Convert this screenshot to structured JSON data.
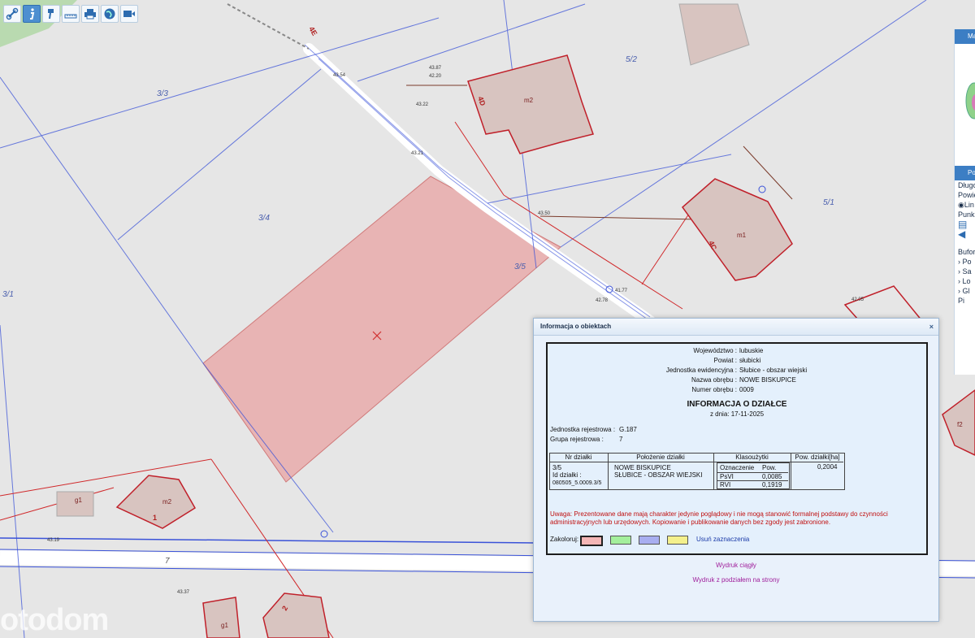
{
  "toolbar": {
    "tools": [
      "link-icon",
      "info-icon",
      "identify-icon",
      "measure-icon",
      "print-icon",
      "globe-icon",
      "video-icon"
    ]
  },
  "map": {
    "parcel_labels": [
      "3/3",
      "3/4",
      "3/5",
      "3/1",
      "5/2",
      "5/1",
      "4E",
      "4D",
      "4C",
      "7"
    ],
    "building_labels": [
      "m2",
      "m1",
      "m2",
      "g1",
      "g1",
      "1",
      "2",
      "f2"
    ],
    "elevations": [
      "43.54",
      "43.21",
      "43.50",
      "42.78",
      "42.20",
      "43.22",
      "43.87",
      "43.19",
      "43.37",
      "42.05",
      "41.77"
    ],
    "colors": {
      "selected_parcel": "#e8b4b4",
      "parcel_line": "#3a52d8",
      "road": "#ffffff",
      "building": "#d8c4c0",
      "building_line": "#c0202a"
    }
  },
  "side_panel": {
    "head1": "Ma",
    "head2": "Po",
    "rows": [
      "Długo",
      "Powie",
      "Lin",
      "Punk",
      "Bufor[",
      "Po",
      "Sa",
      "Lo",
      "Gl",
      "Pi"
    ]
  },
  "dialog": {
    "title": "Informacja o obiektach",
    "close": "×",
    "header": [
      {
        "label": "Województwo :",
        "value": "lubuskie"
      },
      {
        "label": "Powiat :",
        "value": "słubicki"
      },
      {
        "label": "Jednostka ewidencyjna :",
        "value": "Słubice - obszar wiejski"
      },
      {
        "label": "Nazwa obrębu :",
        "value": "NOWE BISKUPICE"
      },
      {
        "label": "Numer obrębu :",
        "value": "0009"
      }
    ],
    "report_title": "INFORMACJA O DZIAŁCE",
    "report_date": "z dnia: 17-11-2025",
    "jr_label": "Jednostka rejestrowa :",
    "jr_value": "G.187",
    "gr_label": "Grupa rejestrowa :",
    "gr_value": "7",
    "table_headers": [
      "Nr działki",
      "Położenie działki",
      "Klasoużytki",
      "Pow. działki[ha]"
    ],
    "parcel_no": "3/5",
    "parcel_id_label": "Id działki :",
    "parcel_id": "080505_5.0009.3/5",
    "location_line1": "NOWE BISKUPICE",
    "location_line2": "SŁUBICE - OBSZAR WIEJSKI",
    "class_headers": [
      "Oznaczenie",
      "Pow."
    ],
    "classes": [
      {
        "code": "PsVI",
        "area": "0,0085"
      },
      {
        "code": "RVI",
        "area": "0,1919"
      }
    ],
    "area_total": "0,2004",
    "warning": "Uwaga: Prezentowane dane mają charakter jedynie poglądowy i nie mogą stanowić formalnej podstawy do czynności administracyjnych lub urzędowych. Kopiowanie i publikowanie danych bez zgody jest zabronione.",
    "color_label": "Zakoloruj:",
    "swatch_colors": [
      "#f4b6b6",
      "#a4ef9c",
      "#a8aef0",
      "#f4f08c"
    ],
    "clear_label": "Usuń zaznaczenia",
    "print_continuous": "Wydruk ciągły",
    "print_pages": "Wydruk z podziałem na strony"
  },
  "watermark": "otodom"
}
